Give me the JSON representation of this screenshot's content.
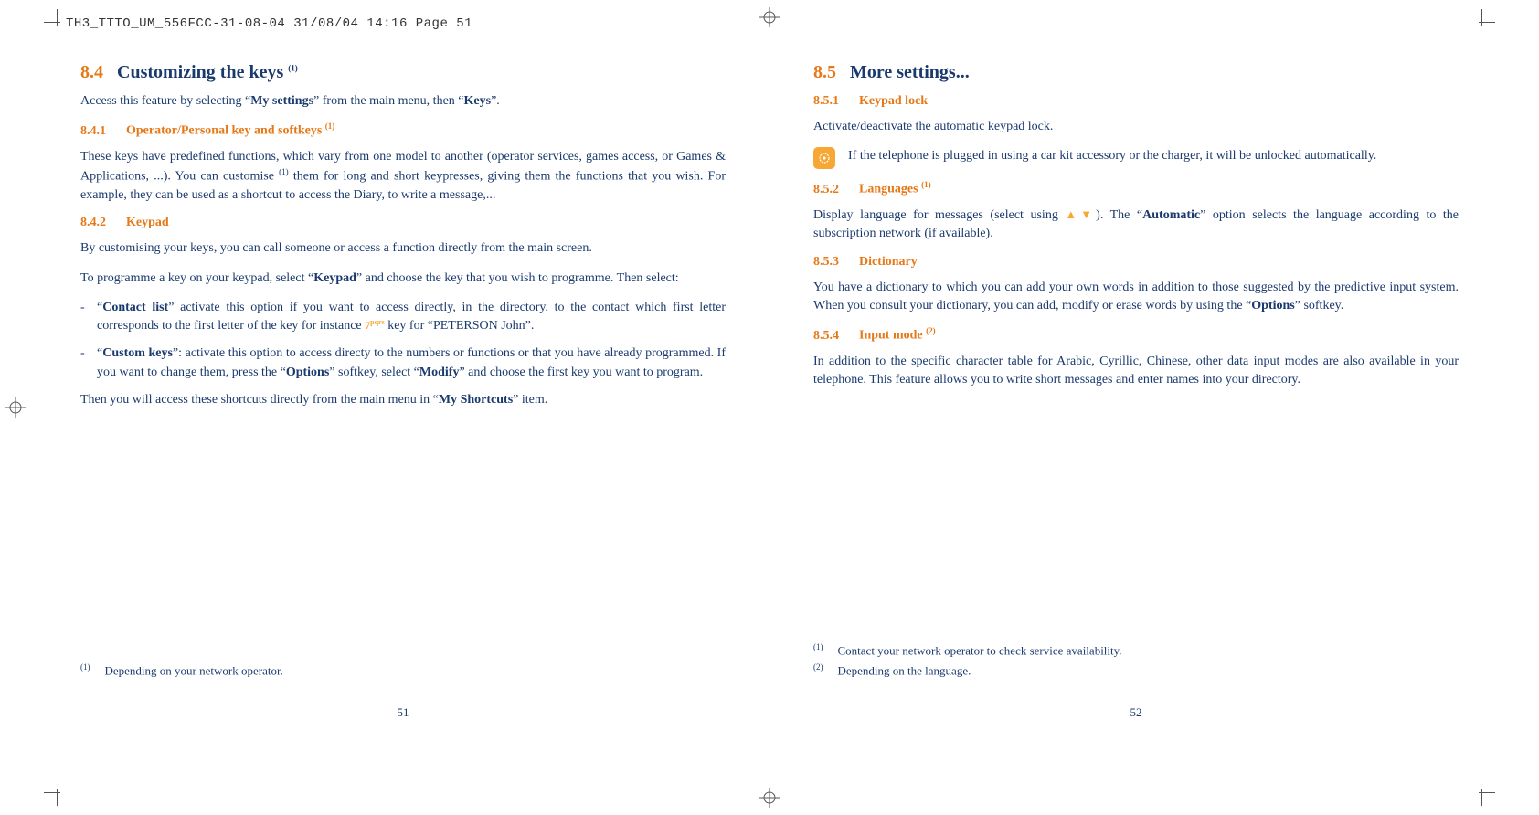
{
  "header": "TH3_TTTO_UM_556FCC-31-08-04  31/08/04  14:16  Page 51",
  "left": {
    "sec_num": "8.4",
    "sec_title": "Customizing the keys",
    "sec_sup": "(1)",
    "intro_a": "Access this feature by selecting “",
    "intro_b": "My settings",
    "intro_c": "” from the main menu, then “",
    "intro_d": "Keys",
    "intro_e": "”.",
    "s1_num": "8.4.1",
    "s1_title": "Operator/Personal key and softkeys",
    "s1_sup": "(1)",
    "s1_para_a": "These keys have predefined functions, which vary from one model to another (operator services, games access, or Games & Applications, ...). You can customise ",
    "s1_para_sup": "(1)",
    "s1_para_b": " them for long and short keypresses, giving them the functions that you wish. For example, they can be used as a shortcut to access the Diary, to write a message,...",
    "s2_num": "8.4.2",
    "s2_title": "Keypad",
    "s2_p1": "By customising your keys, you can call someone or access a function directly from the main screen.",
    "s2_p2_a": "To programme a key on your keypad, select “",
    "s2_p2_b": "Keypad",
    "s2_p2_c": "” and choose the key that you wish to programme. Then select:",
    "b1_a": "“",
    "b1_b": "Contact list",
    "b1_c": "” activate this option if you want to access directly, in the directory, to the contact which first letter corresponds to the first letter of the key for instance ",
    "b1_key": "7",
    "b1_key2": "pqrs",
    "b1_d": " key for “PETERSON John”.",
    "b2_a": "“",
    "b2_b": "Custom keys",
    "b2_c": "”: activate this option to access directy to the numbers or functions or that you have already programmed. If you want to change them, press the “",
    "b2_d": "Options",
    "b2_e": "” softkey, select “",
    "b2_f": "Modify",
    "b2_g": "” and choose the first key you want to program.",
    "s2_p3_a": "Then you will access these shortcuts directly from the main menu in “",
    "s2_p3_b": "My Shortcuts",
    "s2_p3_c": "” item.",
    "fn1_sup": "(1)",
    "fn1": "Depending on your network operator.",
    "page_num": "51"
  },
  "right": {
    "sec_num": "8.5",
    "sec_title": "More settings...",
    "s1_num": "8.5.1",
    "s1_title": "Keypad lock",
    "s1_p1": "Activate/deactivate the automatic keypad lock.",
    "s1_info": "If the telephone is plugged in using a car kit accessory or the charger, it will be unlocked automatically.",
    "s2_num": "8.5.2",
    "s2_title": "Languages",
    "s2_sup": "(1)",
    "s2_p_a": "Display language for messages (select using ",
    "s2_p_b": "). The “",
    "s2_p_c": "Automatic",
    "s2_p_d": "” option selects the language according to the subscription network (if available).",
    "s3_num": "8.5.3",
    "s3_title": "Dictionary",
    "s3_p_a": "You have a dictionary to which you can add your own words in addition to those suggested by the predictive input system. When you consult your dictionary, you can add, modify or erase words by using the “",
    "s3_p_b": "Options",
    "s3_p_c": "” softkey.",
    "s4_num": "8.5.4",
    "s4_title": "Input mode",
    "s4_sup": "(2)",
    "s4_p": "In addition to the specific character table for Arabic, Cyrillic, Chinese, other data input modes are also available in your telephone. This feature allows you to write short messages and enter names into your directory.",
    "fn1_sup": "(1)",
    "fn1": "Contact your network operator to check service availability.",
    "fn2_sup": "(2)",
    "fn2": "Depending on the language.",
    "page_num": "52"
  }
}
